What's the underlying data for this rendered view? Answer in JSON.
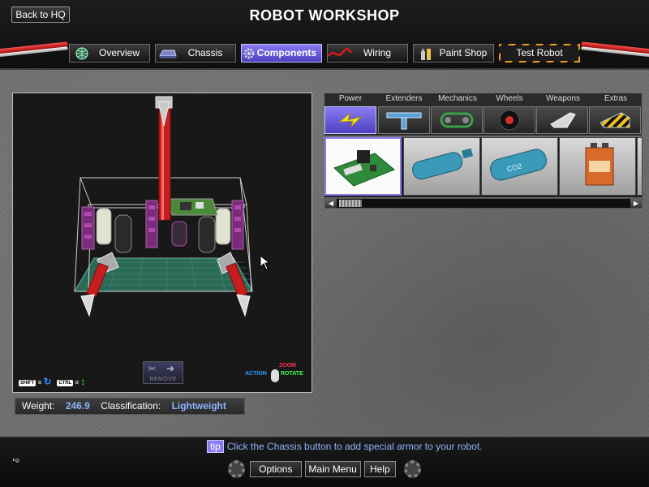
{
  "header": {
    "back_label": "Back to HQ",
    "title": "ROBOT WORKSHOP"
  },
  "tabs": [
    {
      "label": "Overview",
      "icon": "globe-icon",
      "active": false
    },
    {
      "label": "Chassis",
      "icon": "chassis-icon",
      "active": false
    },
    {
      "label": "Components",
      "icon": "gear-icon",
      "active": true
    },
    {
      "label": "Wiring",
      "icon": "wire-icon",
      "active": false
    },
    {
      "label": "Paint Shop",
      "icon": "paint-icon",
      "active": false
    },
    {
      "label": "Test Robot",
      "icon": "",
      "active": false
    }
  ],
  "viewport": {
    "shift_key": "SHIFT",
    "ctrl_key": "CTRL",
    "remove_label": "REMOVE",
    "mouse_action": "ACTION",
    "mouse_zoom": "ZOOM",
    "mouse_rotate": "ROTATE",
    "colors": {
      "action": "#2fa0ff",
      "zoom": "#ff3050",
      "rotate": "#3cff50"
    }
  },
  "stats": {
    "weight_label": "Weight:",
    "weight_value": "246.9",
    "class_label": "Classification:",
    "class_value": "Lightweight"
  },
  "categories": [
    {
      "label": "Power",
      "icon": "lightning-icon",
      "active": true
    },
    {
      "label": "Extenders",
      "icon": "extender-icon",
      "active": false
    },
    {
      "label": "Mechanics",
      "icon": "chain-icon",
      "active": false
    },
    {
      "label": "Wheels",
      "icon": "wheel-icon",
      "active": false
    },
    {
      "label": "Weapons",
      "icon": "blade-icon",
      "active": false
    },
    {
      "label": "Extras",
      "icon": "hazard-icon",
      "active": false
    }
  ],
  "parts": [
    {
      "name": "circuit-board-part",
      "selected": true
    },
    {
      "name": "nitro-tank-part",
      "selected": false
    },
    {
      "name": "co2-tank-part",
      "selected": false
    },
    {
      "name": "battery-part",
      "selected": false
    }
  ],
  "footer": {
    "tip_badge": "tip",
    "tip_text": "Click the Chassis button to add special armor to your robot.",
    "options": "Options",
    "main_menu": "Main Menu",
    "help": "Help"
  },
  "accent": "#8a7cf2",
  "value_color": "#8fb4ff"
}
